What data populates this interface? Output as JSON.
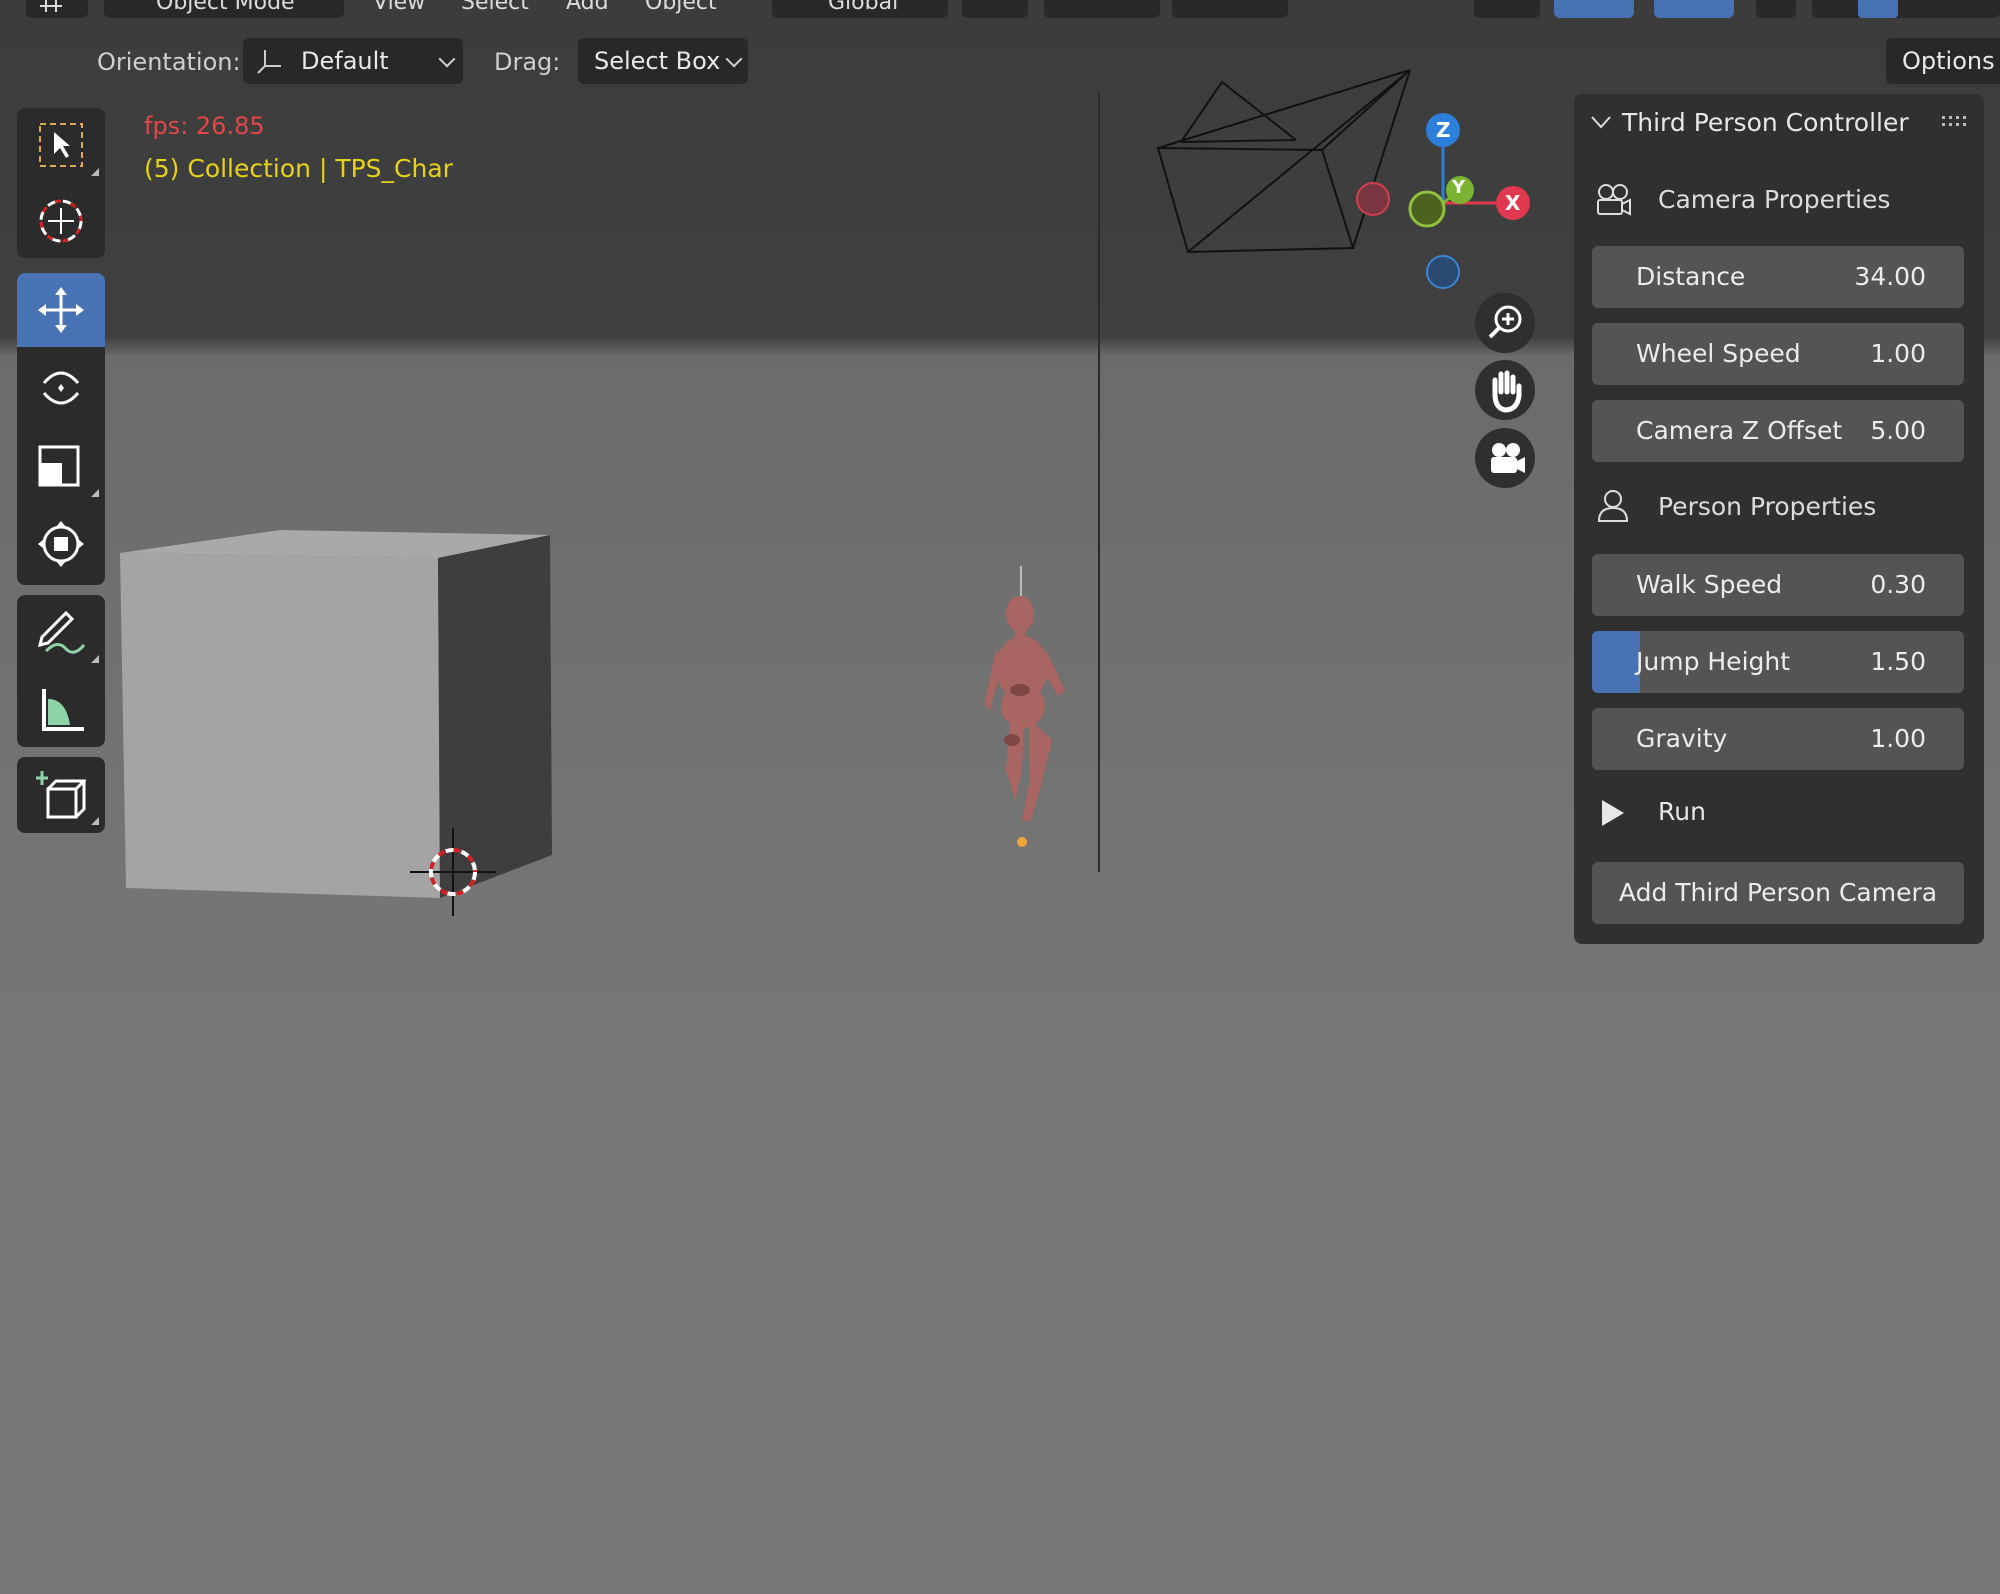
{
  "header": {
    "mode_label": "Object Mode",
    "menus": [
      "View",
      "Select",
      "Add",
      "Object"
    ],
    "transform_orientation": "Global",
    "options_label": "Options"
  },
  "tool_settings": {
    "orientation_label": "Orientation:",
    "orientation_value": "Default",
    "drag_label": "Drag:",
    "drag_value": "Select Box"
  },
  "toolbar": {
    "tools": [
      "select-box",
      "cursor",
      "move",
      "rotate",
      "scale",
      "transform",
      "annotate",
      "measure",
      "add-cube"
    ],
    "active_tool": "move"
  },
  "overlay": {
    "fps": "fps: 26.85",
    "collection": "(5) Collection | TPS_Char"
  },
  "gizmo": {
    "axes": [
      "Z",
      "Y",
      "X"
    ],
    "colors": {
      "x": "#e0384e",
      "y": "#7bb332",
      "z": "#2c7fdb"
    }
  },
  "panel": {
    "title": "Third Person Controller",
    "camera_section": "Camera Properties",
    "distance": {
      "label": "Distance",
      "value": "34.00"
    },
    "wheel_speed": {
      "label": "Wheel Speed",
      "value": "1.00"
    },
    "camera_z_offset": {
      "label": "Camera Z Offset",
      "value": "5.00"
    },
    "person_section": "Person Properties",
    "walk_speed": {
      "label": "Walk Speed",
      "value": "0.30"
    },
    "jump_height": {
      "label": "Jump Height",
      "value": "1.50",
      "slider_fraction": 0.13
    },
    "gravity": {
      "label": "Gravity",
      "value": "1.00"
    },
    "run_label": "Run",
    "add_camera_label": "Add Third Person Camera"
  },
  "colors": {
    "accent": "#4772b3",
    "fps_text": "#e04747",
    "collection_text": "#e6d21b"
  }
}
